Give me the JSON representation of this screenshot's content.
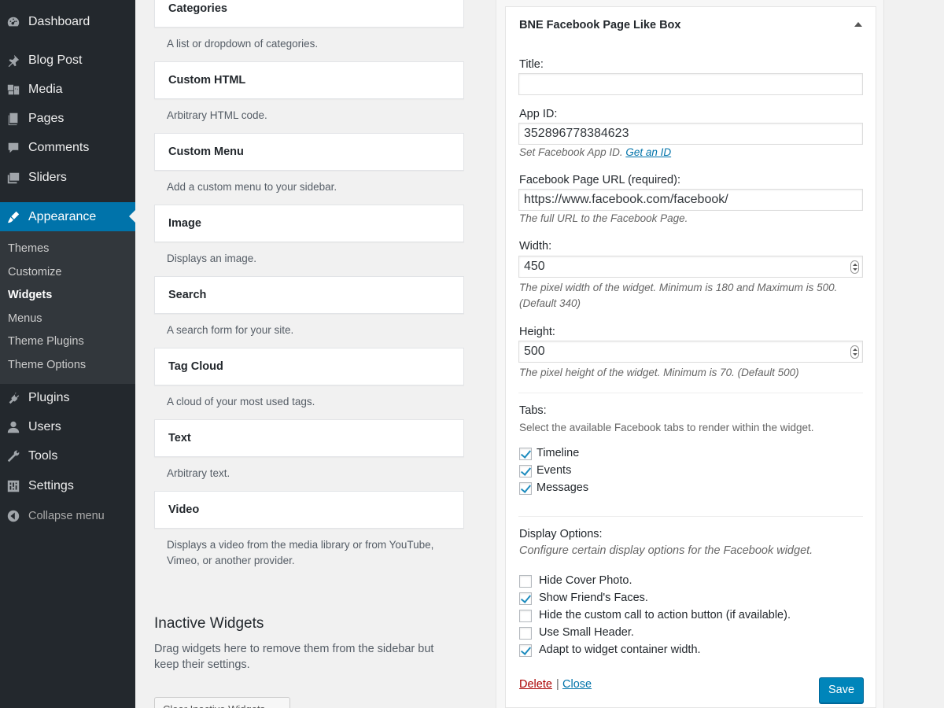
{
  "sidebar": {
    "items": [
      {
        "label": "Dashboard",
        "icon": "dashboard-icon"
      },
      {
        "label": "Blog Post",
        "icon": "pin-icon"
      },
      {
        "label": "Media",
        "icon": "media-icon"
      },
      {
        "label": "Pages",
        "icon": "pages-icon"
      },
      {
        "label": "Comments",
        "icon": "comments-icon"
      },
      {
        "label": "Sliders",
        "icon": "sliders-icon"
      },
      {
        "label": "Appearance",
        "icon": "appearance-icon"
      },
      {
        "label": "Plugins",
        "icon": "plugins-icon"
      },
      {
        "label": "Users",
        "icon": "users-icon"
      },
      {
        "label": "Tools",
        "icon": "tools-icon"
      },
      {
        "label": "Settings",
        "icon": "settings-icon"
      },
      {
        "label": "Collapse menu",
        "icon": "collapse-icon"
      }
    ],
    "submenu": [
      "Themes",
      "Customize",
      "Widgets",
      "Menus",
      "Theme Plugins",
      "Theme Options"
    ],
    "active_color": "#0073aa"
  },
  "available_widgets": [
    {
      "title": "Categories",
      "desc": "A list or dropdown of categories."
    },
    {
      "title": "Custom HTML",
      "desc": "Arbitrary HTML code."
    },
    {
      "title": "Custom Menu",
      "desc": "Add a custom menu to your sidebar."
    },
    {
      "title": "Image",
      "desc": "Displays an image."
    },
    {
      "title": "Search",
      "desc": "A search form for your site."
    },
    {
      "title": "Tag Cloud",
      "desc": "A cloud of your most used tags."
    },
    {
      "title": "Text",
      "desc": "Arbitrary text."
    },
    {
      "title": "Video",
      "desc": "Displays a video from the media library or from YouTube, Vimeo, or another provider."
    }
  ],
  "inactive": {
    "title": "Inactive Widgets",
    "desc": "Drag widgets here to remove them from the sidebar but keep their settings.",
    "clear_button": "Clear Inactive Widgets"
  },
  "widget": {
    "title": "BNE Facebook Page Like Box",
    "title_label": "Title:",
    "title_value": "",
    "app_id_label": "App ID:",
    "app_id_value": "352896778384623",
    "app_id_help": "Set Facebook App ID.",
    "app_id_link": "Get an ID",
    "url_label": "Facebook Page URL (required):",
    "url_value": "https://www.facebook.com/facebook/",
    "url_help": "The full URL to the Facebook Page.",
    "width_label": "Width:",
    "width_value": "450",
    "width_help": "The pixel width of the widget. Minimum is 180 and Maximum is 500. (Default 340)",
    "height_label": "Height:",
    "height_value": "500",
    "height_help": "The pixel height of the widget. Minimum is 70. (Default 500)",
    "tabs_label": "Tabs:",
    "tabs_help": "Select the available Facebook tabs to render within the widget.",
    "tabs": [
      {
        "label": "Timeline",
        "checked": true
      },
      {
        "label": "Events",
        "checked": true
      },
      {
        "label": "Messages",
        "checked": true
      }
    ],
    "display_label": "Display Options:",
    "display_help": "Configure certain display options for the Facebook widget.",
    "display_options": [
      {
        "label": "Hide Cover Photo.",
        "checked": false
      },
      {
        "label": "Show Friend's Faces.",
        "checked": true
      },
      {
        "label": "Hide the custom call to action button (if available).",
        "checked": false
      },
      {
        "label": "Use Small Header.",
        "checked": false
      },
      {
        "label": "Adapt to widget container width.",
        "checked": true
      }
    ],
    "delete_label": "Delete",
    "separator": "|",
    "close_label": "Close",
    "save_label": "Save"
  }
}
